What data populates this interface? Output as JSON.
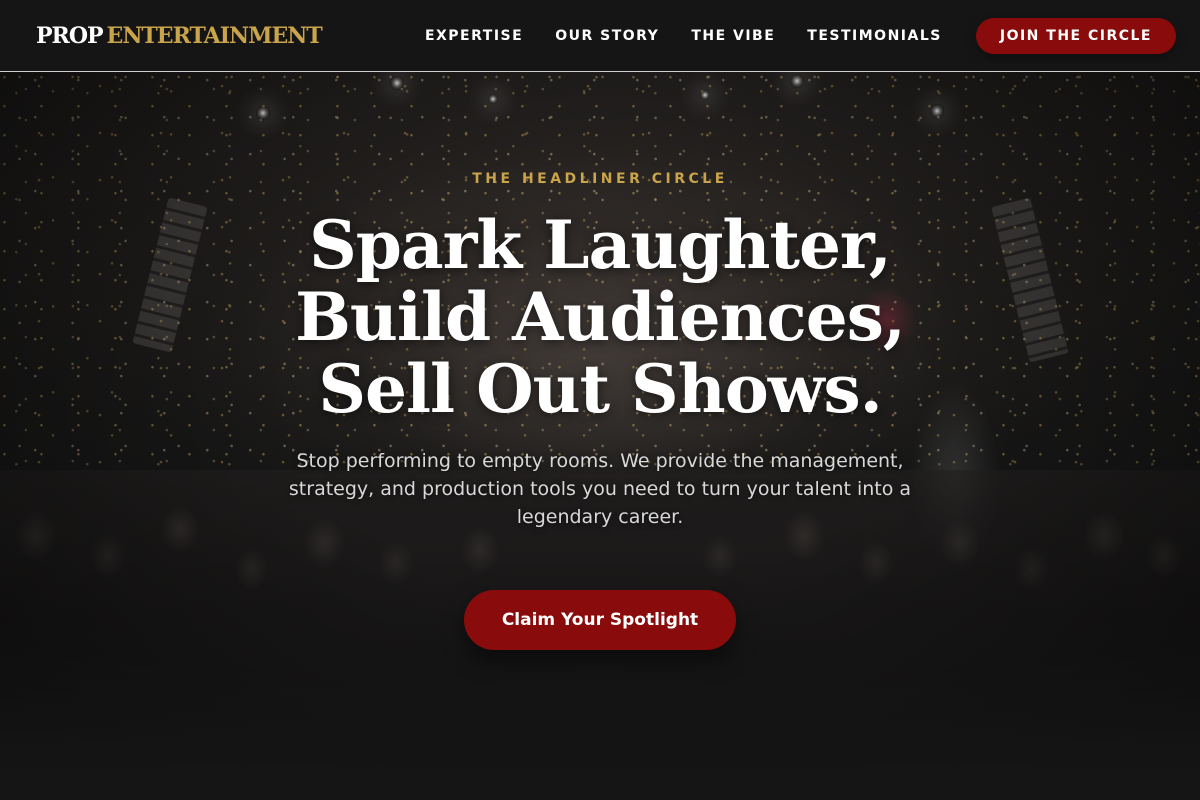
{
  "brand": {
    "name_primary": "PROP",
    "name_secondary": "ENTERTAINMENT"
  },
  "nav": {
    "links": [
      {
        "label": "EXPERTISE"
      },
      {
        "label": "OUR STORY"
      },
      {
        "label": "THE VIBE"
      },
      {
        "label": "TESTIMONIALS"
      }
    ],
    "cta_label": "JOIN THE CIRCLE"
  },
  "hero": {
    "eyebrow": "THE HEADLINER CIRCLE",
    "headline_lines": [
      "Spark Laughter,",
      "Build Audiences,",
      "Sell Out Shows."
    ],
    "subtext": "Stop performing to empty rooms. We provide the management, strategy, and production tools you need to turn your talent into a legendary career.",
    "cta_label": "Claim Your Spotlight"
  },
  "colors": {
    "accent_gold": "#c9a44a",
    "cta_red": "#8a0b0b",
    "background": "#151515",
    "text": "#ffffff"
  },
  "background_image": {
    "icon": "concert-crowd-stage"
  }
}
